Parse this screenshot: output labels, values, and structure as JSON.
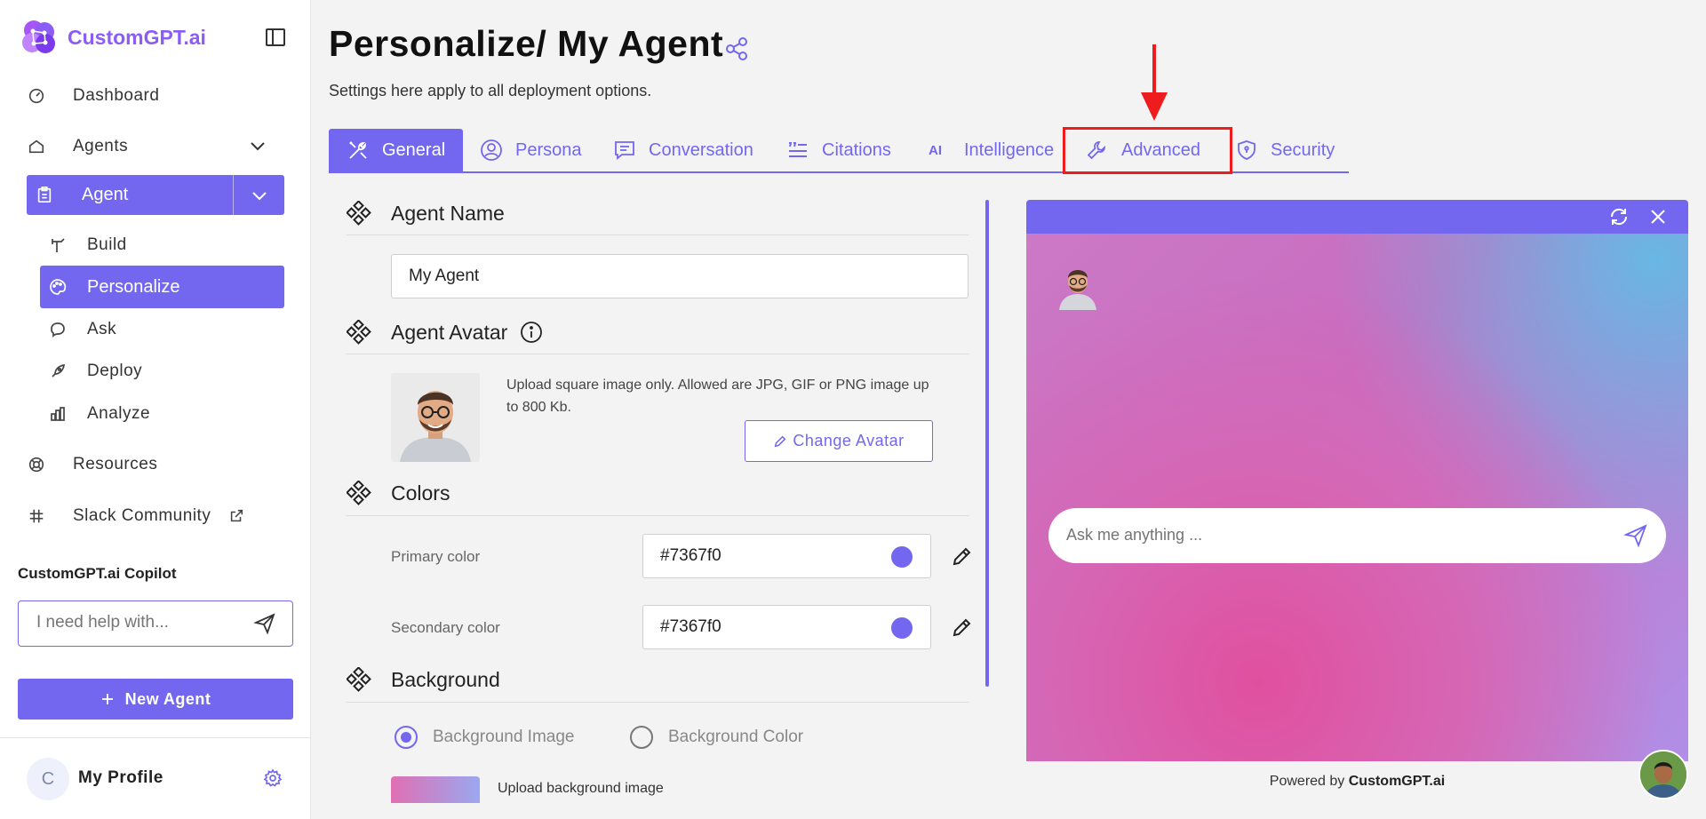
{
  "app": {
    "brand": "CustomGPT.ai",
    "accent": "#7367f0"
  },
  "sidebar": {
    "nav": [
      {
        "label": "Dashboard"
      },
      {
        "label": "Agents"
      }
    ],
    "agent_label": "Agent",
    "sub_items": [
      {
        "label": "Build"
      },
      {
        "label": "Personalize"
      },
      {
        "label": "Ask"
      },
      {
        "label": "Deploy"
      },
      {
        "label": "Analyze"
      }
    ],
    "bottom_nav": [
      {
        "label": "Resources"
      },
      {
        "label": "Slack Community"
      }
    ],
    "copilot_title": "CustomGPT.ai Copilot",
    "copilot_placeholder": "I need help with...",
    "new_agent_label": "New Agent",
    "profile_initial": "C",
    "profile_name": "My Profile"
  },
  "main": {
    "title": "Personalize/ My Agent",
    "subtitle": "Settings here apply to all deployment options.",
    "tabs": [
      {
        "label": "General"
      },
      {
        "label": "Persona"
      },
      {
        "label": "Conversation"
      },
      {
        "label": "Citations"
      },
      {
        "label": "Intelligence"
      },
      {
        "label": "Advanced"
      },
      {
        "label": "Security"
      }
    ]
  },
  "form": {
    "agent_name_title": "Agent Name",
    "agent_name_value": "My Agent",
    "agent_avatar_title": "Agent Avatar",
    "upload_text": "Upload square image only. Allowed are JPG, GIF or PNG image up to 800 Kb.",
    "change_avatar_label": "Change Avatar",
    "colors_title": "Colors",
    "primary_label": "Primary color",
    "primary_value": "#7367f0",
    "secondary_label": "Secondary color",
    "secondary_value": "#7367f0",
    "background_title": "Background",
    "bg_image_label": "Background Image",
    "bg_color_label": "Background Color",
    "upload_bg_label": "Upload background image"
  },
  "preview": {
    "ask_placeholder": "Ask me anything ...",
    "powered_prefix": "Powered by ",
    "powered_brand": "CustomGPT.ai"
  }
}
